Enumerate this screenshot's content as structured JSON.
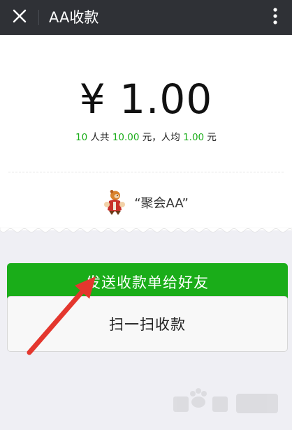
{
  "header": {
    "title": "AA收款",
    "icons": {
      "close": "close-icon",
      "menu": "more-vertical-icon"
    }
  },
  "receipt": {
    "amount": "¥ 1.00",
    "summary": {
      "count": "10",
      "people_label": " 人共 ",
      "total": "10.00",
      "avg_prefix": " 元，人均 ",
      "avg": "1.00",
      "suffix": " 元"
    },
    "note": "“聚会AA”"
  },
  "actions": {
    "send_label": "发送收款单给好友",
    "scan_label": "扫一扫收款"
  },
  "colors": {
    "topbar": "#2f3136",
    "green": "#1aad19",
    "arrow": "#e4372e"
  }
}
